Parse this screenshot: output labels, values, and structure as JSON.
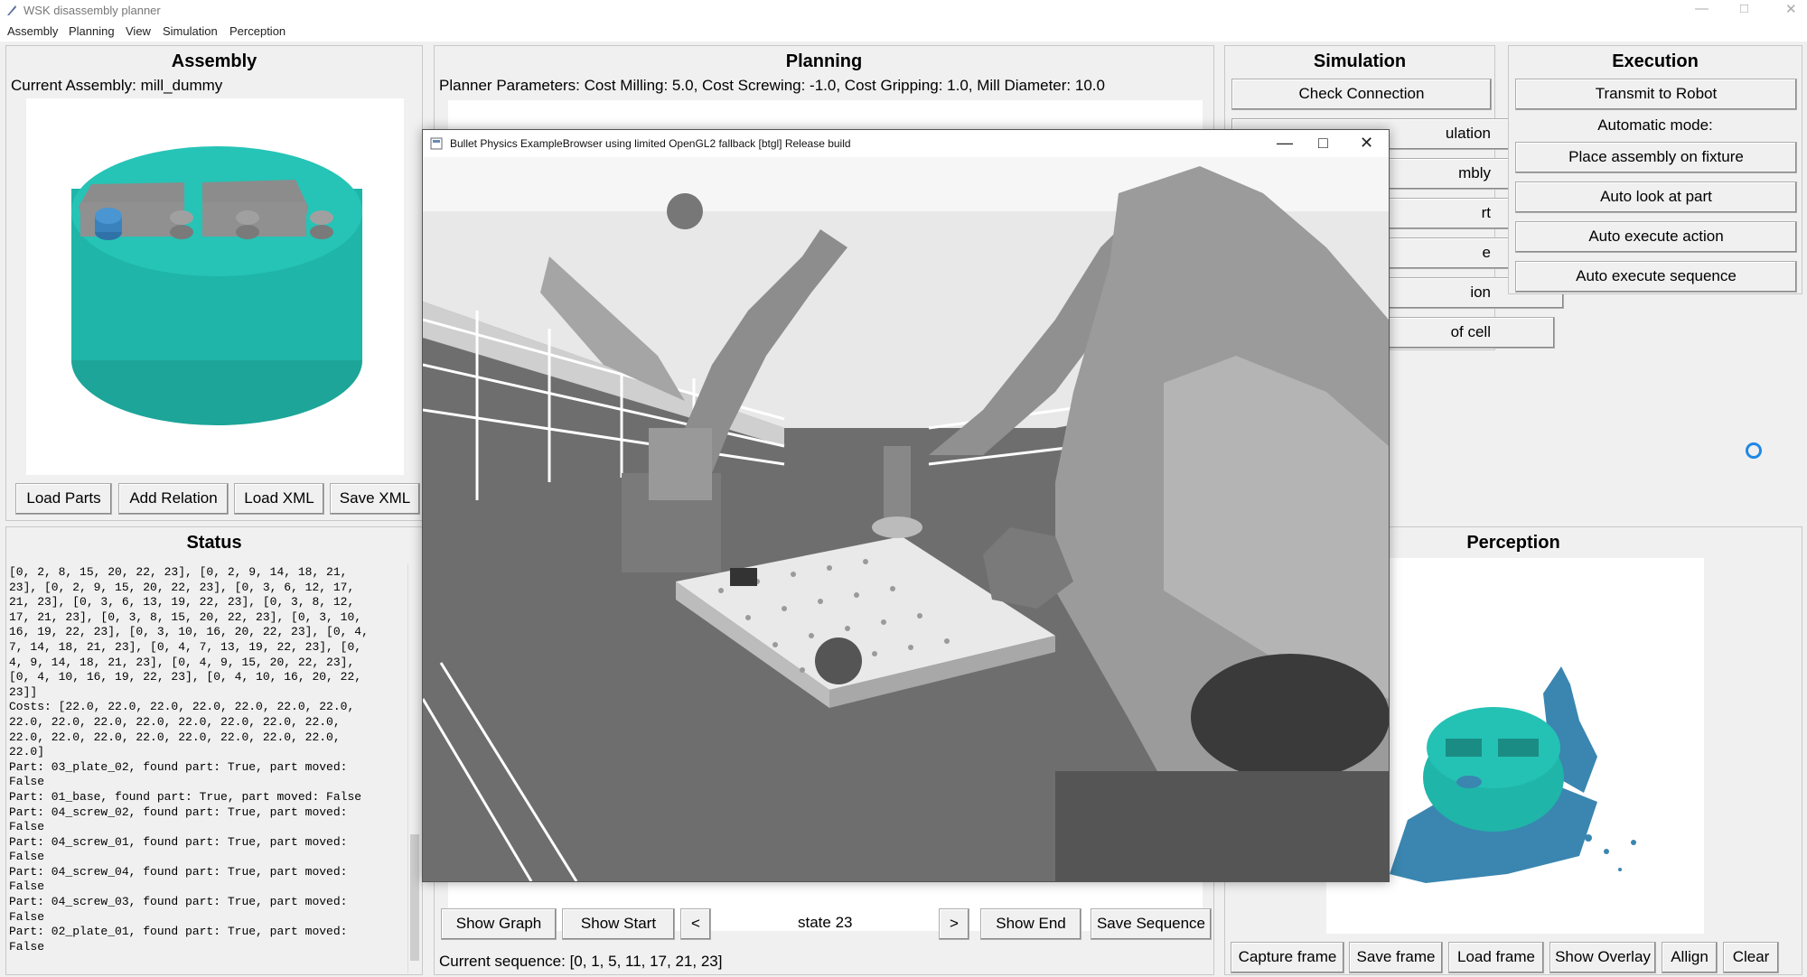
{
  "window": {
    "title": "WSK disassembly planner",
    "controls": [
      "—",
      "□",
      "✕"
    ]
  },
  "menu": [
    "Assembly",
    "Planning",
    "View",
    "Simulation",
    "Perception"
  ],
  "assembly": {
    "title": "Assembly",
    "current": "Current Assembly: mill_dummy",
    "buttons": [
      "Load Parts",
      "Add Relation",
      "Load XML",
      "Save XML"
    ]
  },
  "planning": {
    "title": "Planning",
    "params": "Planner Parameters: Cost Milling: 5.0, Cost Screwing: -1.0, Cost Gripping: 1.0, Mill Diameter: 10.0",
    "buttons": {
      "show_graph": "Show Graph",
      "show_start": "Show Start",
      "prev": "<",
      "state": "state 23",
      "next": ">",
      "show_end": "Show End",
      "save_sequence": "Save Sequence"
    },
    "sequence": "Current sequence: [0, 1, 5, 11, 17, 21, 23]"
  },
  "simulation": {
    "title": "Simulation",
    "buttons": [
      "Check Connection",
      "ulation",
      "mbly",
      "rt",
      "e",
      "ion",
      "of cell"
    ]
  },
  "execution": {
    "title": "Execution",
    "transmit": "Transmit to Robot",
    "auto_mode": "Automatic mode:",
    "buttons": [
      "Place assembly on fixture",
      "Auto look at part",
      "Auto execute action",
      "Auto execute sequence"
    ]
  },
  "status": {
    "title": "Status",
    "lines": [
      "[0, 2, 8, 15, 20, 22, 23], [0, 2, 9, 14, 18, 21,",
      "23], [0, 2, 9, 15, 20, 22, 23], [0, 3, 6, 12, 17,",
      "21, 23], [0, 3, 6, 13, 19, 22, 23], [0, 3, 8, 12,",
      "17, 21, 23], [0, 3, 8, 15, 20, 22, 23], [0, 3, 10,",
      "16, 19, 22, 23], [0, 3, 10, 16, 20, 22, 23], [0, 4,",
      "7, 14, 18, 21, 23], [0, 4, 7, 13, 19, 22, 23], [0,",
      "4, 9, 14, 18, 21, 23], [0, 4, 9, 15, 20, 22, 23],",
      "[0, 4, 10, 16, 19, 22, 23], [0, 4, 10, 16, 20, 22,",
      "23]]",
      "Costs: [22.0, 22.0, 22.0, 22.0, 22.0, 22.0, 22.0,",
      "22.0, 22.0, 22.0, 22.0, 22.0, 22.0, 22.0, 22.0,",
      "22.0, 22.0, 22.0, 22.0, 22.0, 22.0, 22.0, 22.0,",
      "22.0]",
      "Part: 03_plate_02, found part: True, part moved:",
      "False",
      "Part: 01_base, found part: True, part moved: False",
      "Part: 04_screw_02, found part: True, part moved:",
      "False",
      "Part: 04_screw_01, found part: True, part moved:",
      "False",
      "Part: 04_screw_04, found part: True, part moved:",
      "False",
      "Part: 04_screw_03, found part: True, part moved:",
      "False",
      "Part: 02_plate_01, found part: True, part moved:",
      "False"
    ]
  },
  "perception": {
    "title": "Perception",
    "buttons": [
      "Capture frame",
      "Save frame",
      "Load frame",
      "Show Overlay",
      "Allign",
      "Clear"
    ]
  },
  "bullet": {
    "title": "Bullet Physics ExampleBrowser using limited OpenGL2 fallback [btgl] Release build",
    "controls": [
      "—",
      "□",
      "✕"
    ]
  },
  "colors": {
    "teal": "#1fb5a8",
    "plate": "#8a8a8a",
    "sim_bg": "#6e6e6e",
    "spinner": "#1e88e5"
  }
}
